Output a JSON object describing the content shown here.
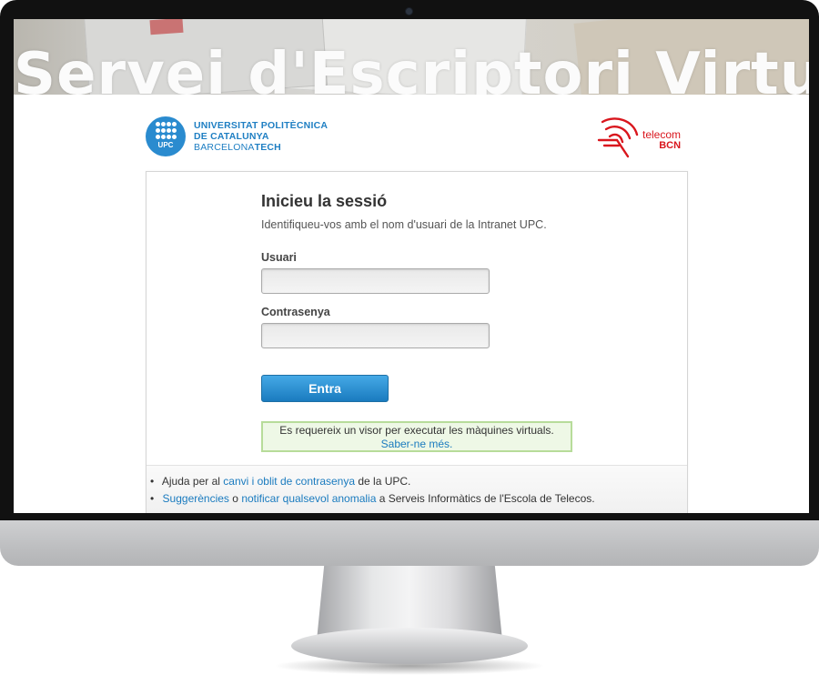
{
  "banner": {
    "title": "Servei d'Escriptori Virtual"
  },
  "upc": {
    "abbr": "UPC",
    "line1": "UNIVERSITAT POLITÈCNICA",
    "line2": "DE CATALUNYA",
    "line3a": "BARCELONA",
    "line3b": "TECH"
  },
  "telecom": {
    "name": "telecom",
    "sub": "BCN"
  },
  "login": {
    "heading": "Inicieu la sessió",
    "subtitle": "Identifiqueu-vos amb el nom d'usuari de la Intranet UPC.",
    "user_label": "Usuari",
    "user_value": "",
    "pass_label": "Contrasenya",
    "pass_value": "",
    "submit": "Entra",
    "notice_text": "Es requereix un visor per executar les màquines virtuals.",
    "notice_link": "Saber-ne més."
  },
  "footer": {
    "help_prefix": "Ajuda per al",
    "help_link": "canvi i oblit de contrasenya",
    "help_suffix": "de la UPC.",
    "sugg_link": "Suggerències",
    "sugg_or": "o",
    "report_link": "notificar qualsevol anomalia",
    "report_suffix": "a Serveis Informàtics de l'Escola de Telecos."
  },
  "colors": {
    "accent": "#1a7bbf",
    "upc_blue": "#2a8bcf",
    "telecom_red": "#d9161d",
    "notice_border": "#b7dc9a"
  }
}
